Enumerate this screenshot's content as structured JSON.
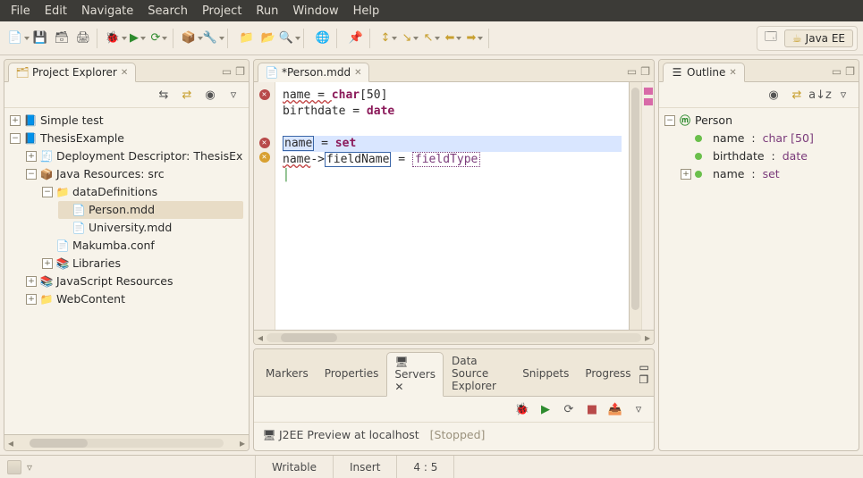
{
  "menu": [
    "File",
    "Edit",
    "Navigate",
    "Search",
    "Project",
    "Run",
    "Window",
    "Help"
  ],
  "perspective": {
    "label": "Java EE"
  },
  "projectExplorer": {
    "title": "Project Explorer",
    "tree": {
      "simpleTest": "Simple test",
      "thesisExample": "ThesisExample",
      "deployDesc": "Deployment Descriptor: ThesisEx",
      "javaRes": "Java Resources: src",
      "dataDefs": "dataDefinitions",
      "personMdd": "Person.mdd",
      "universityMdd": "University.mdd",
      "makumbaConf": "Makumba.conf",
      "libraries": "Libraries",
      "jsRes": "JavaScript Resources",
      "webContent": "WebContent"
    }
  },
  "editor": {
    "tabTitle": "*Person.mdd",
    "lines": {
      "l1a": "name = ",
      "l1b": "char",
      "l1c": "[50]",
      "l2a": "birthdate = ",
      "l2b": "date",
      "l3a": "name",
      "l3b": " = ",
      "l3c": "set",
      "l4a": "name",
      "l4b": "->",
      "l4c": "fieldName",
      "l4d": " = ",
      "l4e": "fieldType"
    }
  },
  "bottom": {
    "tabs": [
      "Markers",
      "Properties",
      "Servers",
      "Data Source Explorer",
      "Snippets",
      "Progress"
    ],
    "activeIndex": 2,
    "server": {
      "name": "J2EE Preview at localhost",
      "state": "[Stopped]"
    }
  },
  "outline": {
    "title": "Outline",
    "root": "Person",
    "items": [
      {
        "label": "name",
        "type": "char [50]"
      },
      {
        "label": "birthdate",
        "type": "date"
      },
      {
        "label": "name",
        "type": "set",
        "expandable": true
      }
    ]
  },
  "status": {
    "mode": "Writable",
    "ins": "Insert",
    "pos": "4 : 5"
  }
}
